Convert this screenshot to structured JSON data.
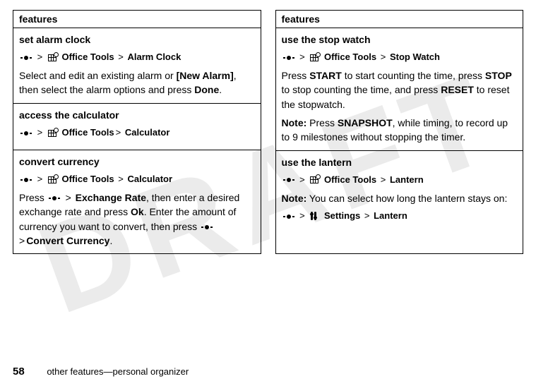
{
  "watermark": "DRAFT",
  "columns": {
    "left": {
      "header": "features",
      "features": [
        {
          "title": "set alarm clock",
          "path_category": "Office Tools",
          "path_item": "Alarm Clock",
          "body_pre": "Select and edit an existing alarm or ",
          "body_bold1": "[New Alarm]",
          "body_mid": ", then select the alarm options and press ",
          "body_bold2": "Done",
          "body_post": "."
        },
        {
          "title": "access the calculator",
          "path_category": "Office Tools",
          "path_sep_tight": true,
          "path_item": "Calculator"
        },
        {
          "title": "convert currency",
          "path_category": "Office Tools",
          "path_item": "Calculator",
          "body2_pre": "Press ",
          "body2_b1": "Exchange Rate",
          "body2_mid1": ", then enter a desired exchange rate and press ",
          "body2_b2": "Ok",
          "body2_mid2": ". Enter the amount of currency you want to convert, then press ",
          "body2_b3": "Convert Currency",
          "body2_post": "."
        }
      ]
    },
    "right": {
      "header": "features",
      "features": [
        {
          "title": "use the stop watch",
          "path_category": "Office Tools",
          "path_item": "Stop Watch",
          "sw_pre": "Press ",
          "sw_b1": "START",
          "sw_mid1": " to start counting the time, press ",
          "sw_b2": "STOP",
          "sw_mid2": " to stop counting the time, and press ",
          "sw_b3": "RESET",
          "sw_mid3": " to reset the stopwatch.",
          "note_label": "Note:",
          "note_pre": " Press ",
          "note_b1": "SNAPSHOT",
          "note_post": ", while timing, to record up to 9 milestones without stopping the timer."
        },
        {
          "title": "use the lantern",
          "path_category": "Office Tools",
          "path_item": "Lantern",
          "note_label": "Note:",
          "note_body": " You can select how long the lantern stays on:",
          "path2_category": "Settings",
          "path2_item": "Lantern"
        }
      ]
    }
  },
  "footer": {
    "page": "58",
    "text": "other features—personal organizer"
  }
}
